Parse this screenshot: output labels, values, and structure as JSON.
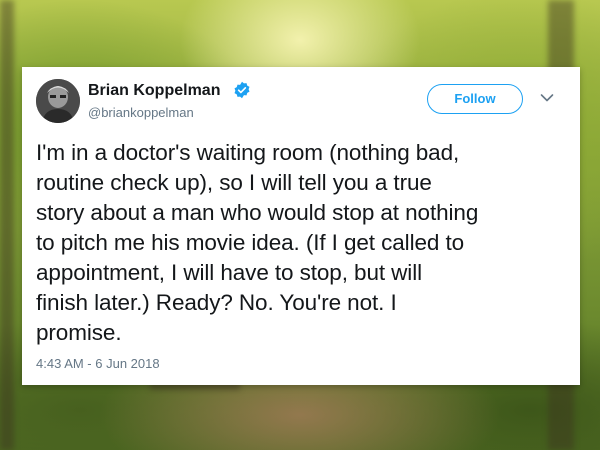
{
  "tweet": {
    "author_name": "Brian Koppelman",
    "author_handle": "@briankoppelman",
    "verified": true,
    "follow_label": "Follow",
    "text_lines": [
      "I'm in a doctor's waiting room (nothing bad,",
      "routine check up), so I will tell you a true",
      "story about a man who would stop at nothing",
      "to pitch me his movie idea. (If I get called to",
      "appointment, I will have to stop, but will",
      "finish later.) Ready? No. You're not. I",
      "promise."
    ],
    "timestamp": "4:43 AM - 6 Jun 2018"
  },
  "icons": {
    "verified": "verified-badge-icon",
    "menu": "chevron-down-icon"
  },
  "colors": {
    "accent": "#1da1f2",
    "text": "#14171a",
    "muted": "#657786"
  }
}
